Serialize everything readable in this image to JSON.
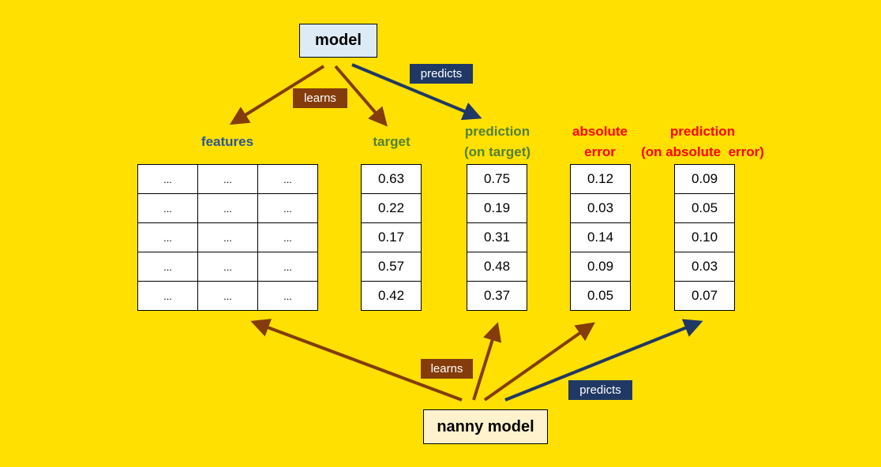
{
  "nodes": {
    "model": "model",
    "nanny_model": "nanny model"
  },
  "edge_labels": {
    "top_learns": "learns",
    "top_predicts": "predicts",
    "bottom_learns": "learns",
    "bottom_predicts": "predicts"
  },
  "colors": {
    "background": "#FFE000",
    "learns": "#843C0C",
    "predicts": "#203864",
    "model_fill": "#DDEBF7",
    "nanny_fill": "#FFF2CC",
    "features_heading": "#2F5597",
    "target_heading": "#538135",
    "error_heading": "#FF0000"
  },
  "columns": {
    "features": {
      "heading": "features",
      "rows": [
        [
          "...",
          "...",
          "..."
        ],
        [
          "...",
          "...",
          "..."
        ],
        [
          "...",
          "...",
          "..."
        ],
        [
          "...",
          "...",
          "..."
        ],
        [
          "...",
          "...",
          "..."
        ]
      ]
    },
    "target": {
      "heading": "target",
      "values": [
        "0.63",
        "0.22",
        "0.17",
        "0.57",
        "0.42"
      ]
    },
    "prediction": {
      "heading": "prediction\n(on target)",
      "values": [
        "0.75",
        "0.19",
        "0.31",
        "0.48",
        "0.37"
      ]
    },
    "absolute_error": {
      "heading": "absolute\nerror",
      "values": [
        "0.12",
        "0.03",
        "0.14",
        "0.09",
        "0.05"
      ]
    },
    "prediction_abs_error": {
      "heading": "prediction\n(on absolute  error)",
      "values": [
        "0.09",
        "0.05",
        "0.10",
        "0.03",
        "0.07"
      ]
    }
  }
}
